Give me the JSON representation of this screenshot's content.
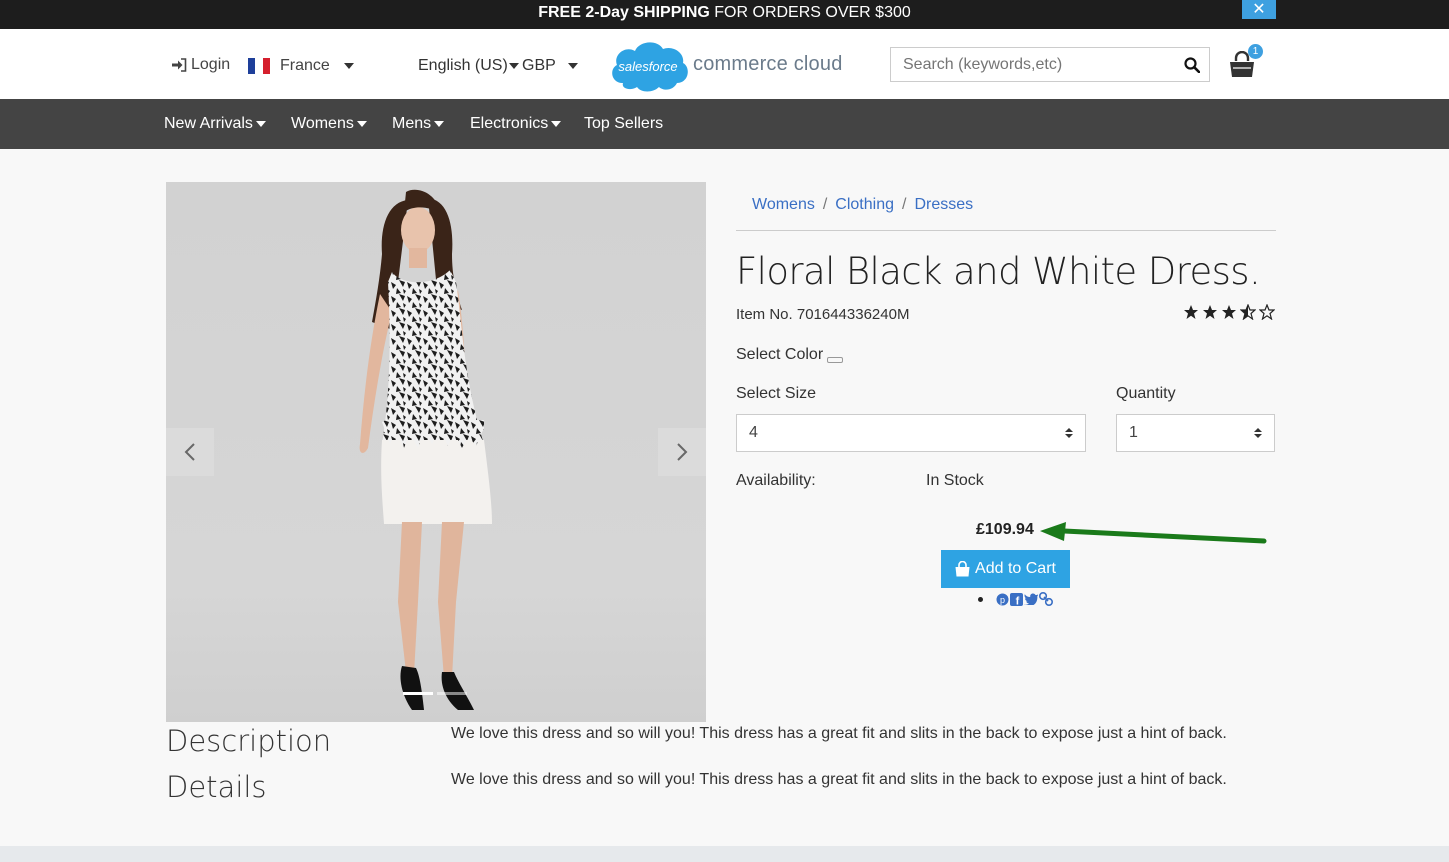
{
  "promo": {
    "bold": "FREE 2-Day SHIPPING",
    "rest": " FOR ORDERS OVER $300",
    "close_icon": "close-icon"
  },
  "header": {
    "login_label": "Login",
    "country_label": "France",
    "language_label": "English (US)",
    "currency_label": "GBP",
    "logo_cloud_text": "salesforce",
    "logo_text": "commerce cloud",
    "search_placeholder": "Search (keywords,etc)",
    "cart_count": "1"
  },
  "nav": {
    "items": [
      "New Arrivals",
      "Womens",
      "Mens",
      "Electronics",
      "Top Sellers"
    ]
  },
  "breadcrumb": [
    "Womens",
    "Clothing",
    "Dresses"
  ],
  "product": {
    "title": "Floral Black and White Dress.",
    "item_no": "Item No. 701644336240M",
    "rating": 3.5,
    "rating_max": 5,
    "select_color_label": "Select Color",
    "select_size_label": "Select Size",
    "size_value": "4",
    "quantity_label": "Quantity",
    "quantity_value": "1",
    "availability_label": "Availability:",
    "availability_value": "In Stock",
    "price": "£109.94",
    "add_to_cart_label": "Add to Cart",
    "image_indicators": 2,
    "active_indicator": 0
  },
  "description": {
    "heading": "Description",
    "text": "We love this dress and so will you! This dress has a great fit and slits in the back to expose just a hint of back."
  },
  "details": {
    "heading": "Details",
    "text": "We love this dress and so will you! This dress has a great fit and slits in the back to expose just a hint of back."
  },
  "colors": {
    "accent": "#2ea3e3",
    "link": "#3a6fc4",
    "nav_bg": "#444444",
    "promo_bg": "#1d1d1d",
    "annotation_arrow": "#1a7a1a"
  }
}
